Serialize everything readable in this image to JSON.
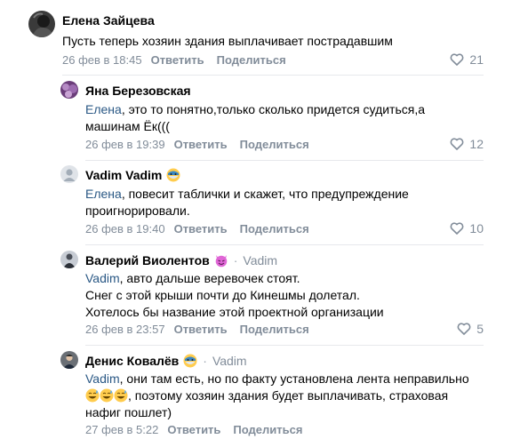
{
  "comments": [
    {
      "author": "Елена Зайцева",
      "text": "Пусть теперь хозяин здания выплачивает пострадавшим",
      "date": "26 фев в 18:45",
      "reply_label": "Ответить",
      "share_label": "Поделиться",
      "likes": "21"
    },
    {
      "author": "Яна Березовская",
      "mention": "Елена",
      "text": ", это то понятно,только сколько придется судиться,а машинам Ёк(((",
      "date": "26 фев в 19:39",
      "reply_label": "Ответить",
      "share_label": "Поделиться",
      "likes": "12"
    },
    {
      "author": "Vadim Vadim",
      "mention": "Елена",
      "text": ", повесит таблички и скажет, что предупреждение проигнорировали.",
      "date": "26 фев в 19:40",
      "reply_label": "Ответить",
      "share_label": "Поделиться",
      "likes": "10"
    },
    {
      "author": "Валерий Виолентов",
      "reply_to": "Vadim",
      "mention": "Vadim",
      "text_line1": ", авто дальше веревочек стоят.",
      "text_line2": "Снег с этой крыши почти до Кинешмы долетал.",
      "text_line3": "Хотелось бы название этой проектной организации",
      "date": "26 фев в 23:57",
      "reply_label": "Ответить",
      "share_label": "Поделиться",
      "likes": "5"
    },
    {
      "author": "Денис Ковалёв",
      "reply_to": "Vadim",
      "mention": "Vadim",
      "text_line1": ", они там есть, но по факту установлена лента неправильно",
      "text_line2": ", поэтому хозяин здания будет выплачивать, страховая",
      "text_line3": "нафиг пошлет)",
      "date": "27 фев в 5:22",
      "reply_label": "Ответить",
      "share_label": "Поделиться"
    }
  ],
  "colors": {
    "link": "#2a5885",
    "muted": "#818c99",
    "divider": "#e7e8ec"
  },
  "icons": {
    "like": "heart-outline-icon",
    "smile": "sweat-smile-emoji",
    "mask": "mask-emoji",
    "devil": "smiling-devil-emoji"
  }
}
